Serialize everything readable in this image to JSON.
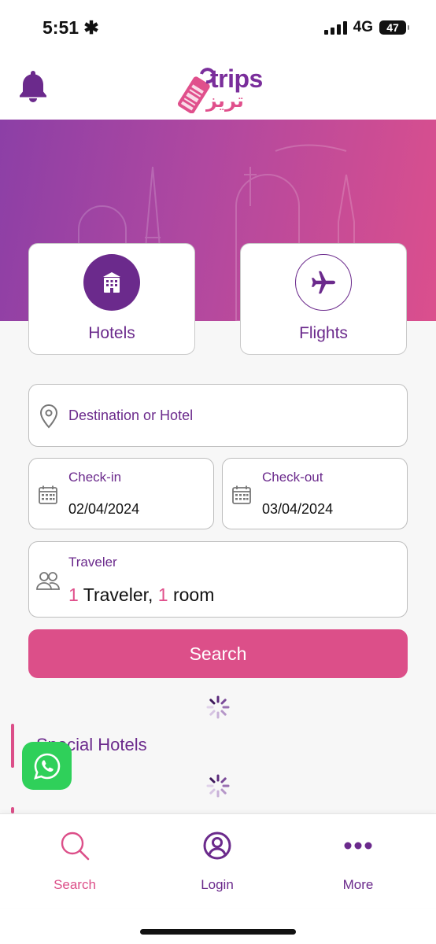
{
  "status_bar": {
    "time": "5:51",
    "network": "4G",
    "battery": "47"
  },
  "header": {
    "logo_text": "trips",
    "logo_arabic": "تريز"
  },
  "tabs": [
    {
      "label": "Hotels",
      "icon": "hotel-icon",
      "active": true
    },
    {
      "label": "Flights",
      "icon": "airplane-icon",
      "active": false
    }
  ],
  "form": {
    "destination_placeholder": "Destination or Hotel",
    "checkin_label": "Check-in",
    "checkin_value": "02/04/2024",
    "checkout_label": "Check-out",
    "checkout_value": "03/04/2024",
    "traveler_label": "Traveler",
    "traveler_count": "1",
    "traveler_word": " Traveler, ",
    "room_count": "1",
    "room_word": " room",
    "search_label": "Search"
  },
  "sections": {
    "special_hotels": "Special Hotels"
  },
  "bottom_nav": [
    {
      "label": "Search",
      "icon": "search-icon",
      "color": "#dc4f89"
    },
    {
      "label": "Login",
      "icon": "user-circle-icon",
      "color": "#6b2a8c"
    },
    {
      "label": "More",
      "icon": "more-dots-icon",
      "color": "#6b2a8c"
    }
  ],
  "colors": {
    "primary_purple": "#6b2a8c",
    "accent_pink": "#dc4f89",
    "whatsapp_green": "#2fd05a"
  }
}
